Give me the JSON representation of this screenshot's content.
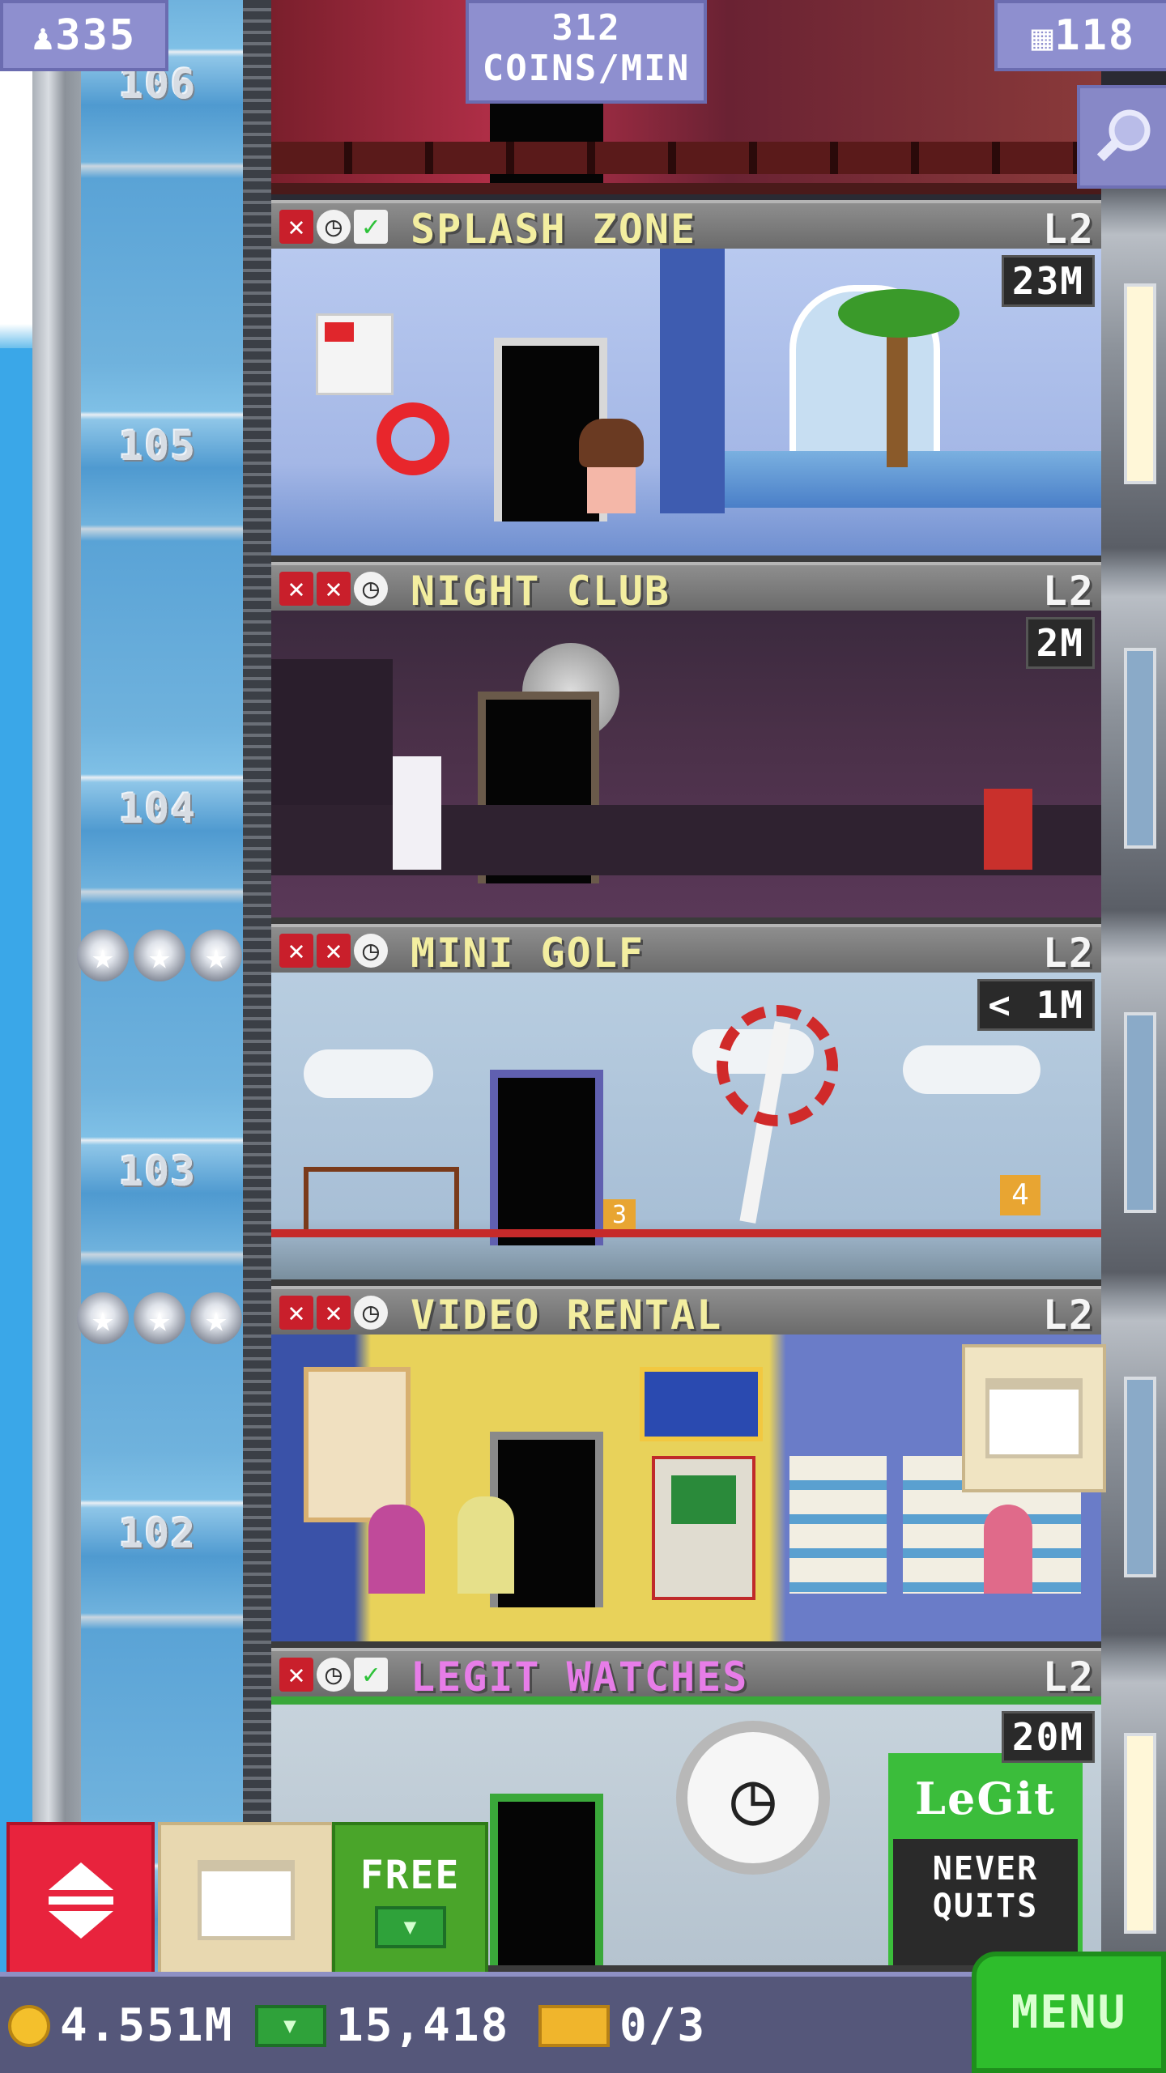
{
  "hud": {
    "population": "335",
    "coin_rate_value": "312",
    "coin_rate_unit": "COINS/MIN",
    "floor_count": "118",
    "icons": {
      "population": "person-icon",
      "floors": "building-icon",
      "search": "magnifier-icon"
    }
  },
  "shaft": {
    "floor_numbers": [
      "106",
      "105",
      "104",
      "103",
      "102"
    ],
    "star_rows": [
      {
        "floor": "104",
        "stars": 3
      },
      {
        "floor": "103",
        "stars": 3
      }
    ]
  },
  "floors": [
    {
      "name": "SPLASH ZONE",
      "level": "L2",
      "timer": "23M",
      "status": [
        "x",
        "clock",
        "check"
      ],
      "name_color": "#f3eea0"
    },
    {
      "name": "NIGHT CLUB",
      "level": "L2",
      "timer": "2M",
      "status": [
        "x",
        "x",
        "clock"
      ],
      "name_color": "#f3eea0"
    },
    {
      "name": "MINI GOLF",
      "level": "L2",
      "timer": "< 1M",
      "status": [
        "x",
        "x",
        "clock"
      ],
      "name_color": "#f3eea0"
    },
    {
      "name": "VIDEO RENTAL",
      "level": "L2",
      "timer": "",
      "status": [
        "x",
        "x",
        "clock"
      ],
      "name_color": "#f3eea0"
    },
    {
      "name": "LEGIT WATCHES",
      "level": "L2",
      "timer": "20M",
      "status": [
        "x",
        "clock",
        "check"
      ],
      "name_color": "#e77de8"
    }
  ],
  "room_signs": {
    "golf_hole_a": "3",
    "golf_hole_b": "4",
    "legit_logo": "LeGit",
    "legit_slogan_1": "NEVER",
    "legit_slogan_2": "QUITS"
  },
  "controls": {
    "free_label": "FREE",
    "menu_label": "MENU"
  },
  "bottom_bar": {
    "coins": "4.551M",
    "bux": "15,418",
    "tickets": "0/3"
  },
  "colors": {
    "elevator_button": "#e8233d",
    "free_button": "#4aa52a",
    "menu_button": "#2ebd2c",
    "hud_panel": "#8e8fcf",
    "bottom_bar": "#55577a"
  }
}
